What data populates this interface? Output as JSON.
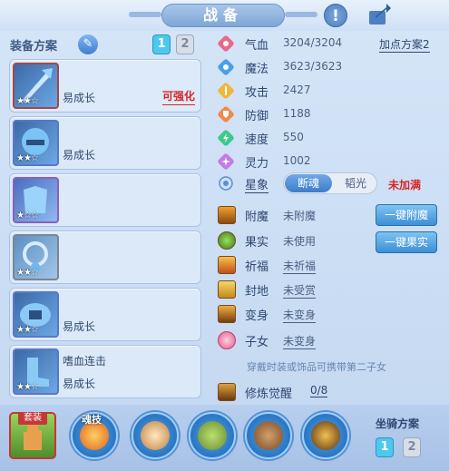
{
  "window": {
    "title": "战备"
  },
  "equip": {
    "plan_label": "装备方案",
    "pages": [
      "1",
      "2"
    ],
    "slots": [
      {
        "name": "",
        "sub": "易成长",
        "tag": "可强化",
        "stars": "★★☆"
      },
      {
        "name": "",
        "sub": "易成长",
        "tag": "",
        "stars": "★★☆"
      },
      {
        "name": "",
        "sub": "",
        "tag": "",
        "stars": "★☆☆"
      },
      {
        "name": "",
        "sub": "",
        "tag": "",
        "stars": "★★☆"
      },
      {
        "name": "",
        "sub": "易成长",
        "tag": "",
        "stars": "★★☆"
      },
      {
        "name": "嗜血连击",
        "sub": "易成长",
        "tag": "",
        "stars": "★★☆"
      }
    ]
  },
  "stats": {
    "plus_plan": "加点方案2",
    "items": [
      {
        "label": "气血",
        "value": "3204/3204",
        "icon": "heart-icon",
        "color": "#e86a8a"
      },
      {
        "label": "魔法",
        "value": "3623/3623",
        "icon": "mana-icon",
        "color": "#4aa0e8"
      },
      {
        "label": "攻击",
        "value": "2427",
        "icon": "attack-icon",
        "color": "#f2b63a"
      },
      {
        "label": "防御",
        "value": "1188",
        "icon": "defense-icon",
        "color": "#f08a4a"
      },
      {
        "label": "速度",
        "value": "550",
        "icon": "speed-icon",
        "color": "#3ec98a"
      },
      {
        "label": "灵力",
        "value": "1002",
        "icon": "spirit-icon",
        "color": "#c47ae8"
      }
    ],
    "xingxiang_label": "星象",
    "toggle": [
      "断魂",
      "韬光"
    ],
    "not_full": "未加满"
  },
  "abilities": [
    {
      "label": "附魔",
      "value": "未附魔",
      "underline": false
    },
    {
      "label": "果实",
      "value": "未使用",
      "underline": false
    },
    {
      "label": "祈福",
      "value": "未祈福",
      "underline": true
    },
    {
      "label": "封地",
      "value": "未受赏",
      "underline": true
    },
    {
      "label": "变身",
      "value": "未变身",
      "underline": true
    },
    {
      "label": "子女",
      "value": "未变身",
      "underline": true
    }
  ],
  "buttons": {
    "enchant": "一键附魔",
    "fruit": "一键果实"
  },
  "note": "穿戴时装或饰品可携带第二子女",
  "awaken": {
    "label": "修炼觉醒",
    "value": "0/8"
  },
  "bottom": {
    "suit": "套装",
    "soul": "魂技",
    "mount_label": "坐骑方案",
    "mount_pages": [
      "1",
      "2"
    ]
  }
}
